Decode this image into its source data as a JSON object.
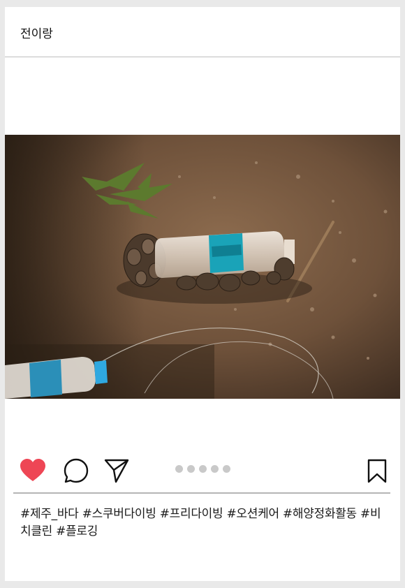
{
  "post": {
    "username": "전이랑",
    "image": {
      "subject": "plastic-bottle-with-barnacles-on-beach"
    },
    "actions": {
      "like_icon": "heart-filled-icon",
      "comment_icon": "comment-bubble-icon",
      "share_icon": "paper-plane-icon",
      "save_icon": "bookmark-icon",
      "like_color": "#ee4655",
      "carousel_dots": 5
    },
    "hashtags": [
      "#제주_바다",
      "#스쿠버다이빙",
      "#프리다이빙",
      "#오션케어",
      "#해양정화활동",
      "#비치클린",
      "#플로깅"
    ]
  },
  "colors": {
    "page_background": "#e9e9e9",
    "card_background": "#ffffff",
    "divider": "#b5b5b5",
    "dot": "#c9c9c9"
  }
}
